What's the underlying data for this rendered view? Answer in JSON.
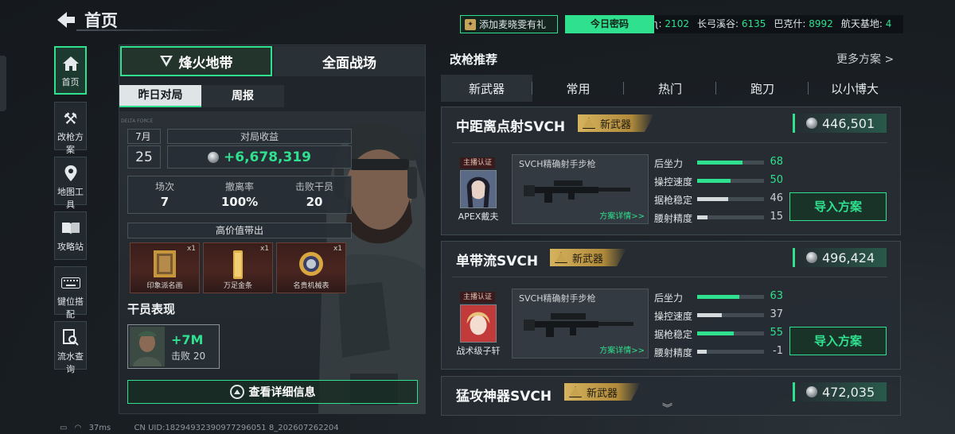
{
  "header": {
    "title": "首页",
    "promo": "添加麦晓雯有礼",
    "promo_icon": "gift-icon",
    "password_button": "今日密码"
  },
  "ticker": [
    {
      "label": "ʅ:",
      "value": "2102"
    },
    {
      "label": "长弓溪谷:",
      "value": "6135"
    },
    {
      "label": "巴克什:",
      "value": "8992"
    },
    {
      "label": "航天基地:",
      "value": "4"
    }
  ],
  "sidebar": [
    {
      "label": "首页",
      "icon": "home-icon",
      "active": true
    },
    {
      "label": "改枪方案",
      "icon": "tools-icon"
    },
    {
      "label": "地图工具",
      "icon": "map-pin-icon"
    },
    {
      "label": "攻略站",
      "icon": "book-icon"
    },
    {
      "label": "键位搭配",
      "icon": "keyboard-icon"
    },
    {
      "label": "流水查询",
      "icon": "search-doc-icon"
    }
  ],
  "left": {
    "mode_tabs": [
      "烽火地带",
      "全面战场"
    ],
    "sub_tabs": [
      "昨日对局",
      "周报"
    ],
    "month": "7月",
    "day": "25",
    "income_label": "对局收益",
    "income_value": "+6,678,319",
    "stats": [
      {
        "label": "场次",
        "value": "7"
      },
      {
        "label": "撤离率",
        "value": "100%"
      },
      {
        "label": "击败干员",
        "value": "20"
      }
    ],
    "high_value_title": "高价值带出",
    "items": [
      {
        "name": "印象派名画",
        "count": "x1"
      },
      {
        "name": "万足金条",
        "count": "x1"
      },
      {
        "name": "名贵机械表",
        "count": "x1"
      }
    ],
    "agent_title": "干员表现",
    "agent_value": "+7M",
    "agent_kills": "击败 20",
    "detail_button": "查看详细信息"
  },
  "right": {
    "title": "改枪推荐",
    "more": "更多方案 >",
    "tabs": [
      "新武器",
      "常用",
      "热门",
      "跑刀",
      "以小博大"
    ],
    "cards": [
      {
        "name": "中距离点射SVCH",
        "tag": "新武器",
        "price": "446,501",
        "badge": "主播认证",
        "author": "APEX戴夫",
        "gun": "SVCH精确射手步枪",
        "link": "方案详情>>",
        "stats": [
          {
            "label": "后坐力",
            "value": "68"
          },
          {
            "label": "操控速度",
            "value": "50"
          },
          {
            "label": "据枪稳定",
            "value": "46"
          },
          {
            "label": "腰射精度",
            "value": "15"
          }
        ],
        "import": "导入方案"
      },
      {
        "name": "单带流SVCH",
        "tag": "新武器",
        "price": "496,424",
        "badge": "主播认证",
        "author": "战术级子轩",
        "gun": "SVCH精确射手步枪",
        "link": "方案详情>>",
        "stats": [
          {
            "label": "后坐力",
            "value": "63"
          },
          {
            "label": "操控速度",
            "value": "37"
          },
          {
            "label": "据枪稳定",
            "value": "55"
          },
          {
            "label": "腰射精度",
            "value": "-1"
          }
        ],
        "import": "导入方案"
      },
      {
        "name": "猛攻神器SVCH",
        "tag": "新武器",
        "price": "472,035"
      }
    ]
  },
  "footer": {
    "ping": "37ms",
    "uid": "CN UID:18294932390977296051 8_202607262204"
  },
  "colors": {
    "accent": "#2fe08e",
    "gold": "#c9a552",
    "bg": "#15191d"
  }
}
